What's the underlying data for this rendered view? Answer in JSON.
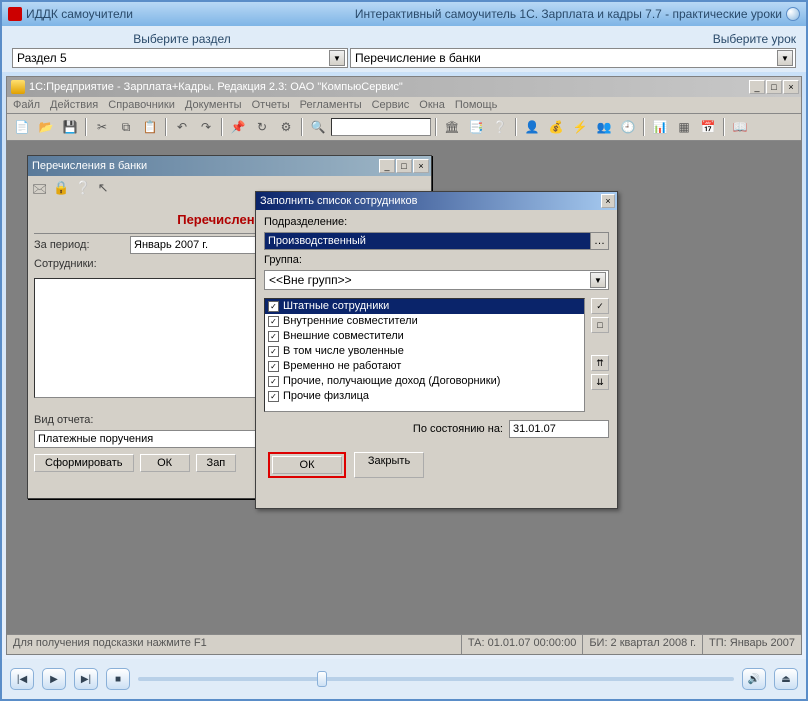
{
  "outer": {
    "app_title": "ИДДК самоучители",
    "subtitle": "Интерактивный самоучитель 1С. Зарплата и кадры 7.7 - практические уроки",
    "col1_label": "Выберите раздел",
    "col2_label": "Выберите урок",
    "section_value": "Раздел 5",
    "lesson_value": "Перечисление в банки"
  },
  "inner_window_title": "1С:Предприятие - Зарплата+Кадры. Редакция 2.3: ОАО \"КомпьюСервис\"",
  "menu": [
    "Файл",
    "Действия",
    "Справочники",
    "Документы",
    "Отчеты",
    "Регламенты",
    "Сервис",
    "Окна",
    "Помощь"
  ],
  "transfer": {
    "title": "Перечисления в банки",
    "heading": "Перечисления в",
    "period_label": "За период:",
    "period_value": "Январь 2007 г.",
    "employees_label": "Сотрудники:",
    "report_type_label": "Вид отчета:",
    "report_type_value": "Платежные поручения",
    "buttons": {
      "form": "Сформировать",
      "ok": "ОК",
      "fill": "Зап"
    }
  },
  "dialog": {
    "title": "Заполнить список сотрудников",
    "subdivision_label": "Подразделение:",
    "subdivision_value": "Производственный",
    "group_label": "Группа:",
    "group_value": "<<Вне групп>>",
    "checks": [
      "Штатные сотрудники",
      "Внутренние совместители",
      "Внешние совместители",
      "В том числе уволенные",
      "Временно не работают",
      "Прочие, получающие доход (Договорники)",
      "Прочие физлица"
    ],
    "date_label": "По состоянию на:",
    "date_value": "31.01.07",
    "ok": "ОК",
    "close": "Закрыть"
  },
  "status": {
    "hint": "Для получения подсказки нажмите F1",
    "ta": "ТА: 01.01.07  00:00:00",
    "bi": "БИ: 2 квартал 2008 г.",
    "tp": "ТП: Январь 2007"
  }
}
